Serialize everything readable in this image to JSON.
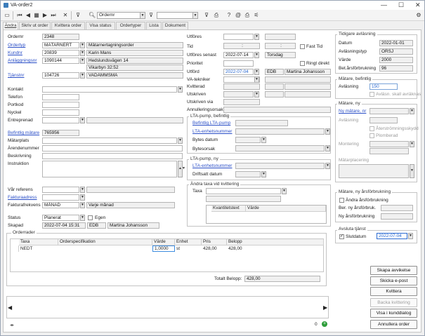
{
  "window": {
    "title": "VA-order2",
    "min": "—",
    "max": "☐",
    "close": "✕"
  },
  "toolbar": {
    "search_label": "Ordernr",
    "search_value": ""
  },
  "tabs": [
    "Ändra",
    "Skriv ut order",
    "Kvittera order",
    "Visa status",
    "Ordertyper",
    "Lista",
    "Dokument"
  ],
  "left": {
    "ordernr_label": "Ordernr",
    "ordernr": "2348",
    "ordertyp_label": "Ordertyp",
    "ordertyp": "MÄTARNERT",
    "ordertyp_desc": "Mätarnertagningsorder",
    "kundnr_label": "Kundnr",
    "kundnr": "20839",
    "kund_namn": "Karin Mans",
    "anlaggning_label": "Anläggningsnr",
    "anlaggning": "1090144",
    "adress1": "Hedslundsvägen 14",
    "adress2": "Vikarbyn 32:52",
    "tjanst_label": "Tjänstnr",
    "tjanst": "104726",
    "tjanst_desc": "VADÄMMSMÄ",
    "kontakt_label": "Kontakt",
    "telefon_label": "Telefon",
    "portkod_label": "Portkod",
    "nyckel_label": "Nyckel",
    "entreprenad_label": "Entreprenad",
    "matare_label": "Befintlig mätare",
    "matare": "765956",
    "matarplats_label": "Mätarplats",
    "arendenummer_label": "Ärendenummer",
    "beskrivning_label": "Beskrivning",
    "instruktion_label": "Instruktion",
    "referens_label": "Vår referens",
    "faktura_label": "Fakturaadress",
    "frekvens_label": "Fakturafrekvens",
    "frekvens": "MÅNAD",
    "frekvens_desc": "Varje månad",
    "status_label": "Status",
    "status": "Planerat",
    "egen_label": "Egen",
    "skapad_label": "Skapad",
    "skapad": "2022-07-04 15:31",
    "skapad_av": "EDB",
    "skapad_namn": "Martina Johansson"
  },
  "mid": {
    "utfores_label": "Utföres",
    "tid_label": "Tid",
    "tid_sep": ":",
    "utfores_senast_label": "Utföres senast",
    "utfores_senast": "2022-07-14",
    "dag": "Torsdag",
    "fast_tid_label": "Fast Tid",
    "prioritet_label": "Prioritet",
    "ringt_label": "Ringt direkt",
    "utford_label": "Utförd",
    "utford": "2022-07-04",
    "utford_av": "EDB",
    "utford_namn": "Martina Johansson",
    "vatekniker_label": "VA-tekniker",
    "kvitterad_label": "Kvitterad",
    "utskriven_label": "Utskriven",
    "utskriven_via_label": "Utskriven via",
    "annullering_label": "Annulleringsorsak",
    "lta_bef_title": "LTA-pump, befintlig",
    "lta_bef_pump": "Befintlig LTA-pump",
    "lta_bef_enhet": "LTA-enhetsnummer",
    "bytes_datum": "Bytes datum",
    "bytesorsak": "Bytesorsak",
    "lta_ny_title": "LTA-pump, ny",
    "lta_ny_enhet": "LTA-enhetsnummer",
    "driftsatt": "Driftsatt datum",
    "taxa_title": "Ändra taxa vid kvittering",
    "taxa_label": "Taxa",
    "taxa_col1": "Kvantitetstext",
    "taxa_col2": "Värde"
  },
  "right": {
    "tidigare_title": "Tidigare avläsning",
    "datum_label": "Datum",
    "datum": "2022-01-01",
    "typ_label": "Avläsningstyp",
    "typ": "ORSJ",
    "varde_label": "Värde",
    "varde": "2000",
    "bet_label": "Bet.årsförbrukning",
    "bet": "96",
    "bef_title": "Mätare, befintlig",
    "avl_label": "Avläsning",
    "avl": "150",
    "avl_chk_label": "Avläsn. skall avräknas",
    "ny_title": "Mätare, ny",
    "ny_matare_label": "Ny mätare, nr",
    "ny_avl_label": "Avläsning",
    "aterstr_label": "Återströmningsskydd",
    "plomb_label": "Plomberad",
    "montering_label": "Montering",
    "placering_label": "Mätarplacering",
    "ars_title": "Mätare, ny årsförbrukning",
    "andra_ars_label": "Ändra årsförbrukning",
    "ber_label": "Ber. ny årsförbruk.",
    "ny_ars_label": "Ny årsförbrukning",
    "avsluta_title": "Avsluta tjänst",
    "slutdatum_label": "Slutdatum",
    "slutdatum": "2022-07-04"
  },
  "orderrader": {
    "title": "Orderrader",
    "columns": [
      "Taxa",
      "Orderspecifikation",
      "Värde",
      "Enhet",
      "Pris",
      "Belopp"
    ],
    "rows": [
      {
        "taxa": "NEDT",
        "spec": "",
        "varde": "1,0000",
        "enhet": "st",
        "pris": "428,00",
        "belopp": "428,00"
      }
    ],
    "total_label": "Totalt Belopp:",
    "total": "428,00"
  },
  "buttons": [
    "Skapa avvikelse",
    "Skicka e-post",
    "Kvittera",
    "Backa kvittering",
    "Visa i kunddialog",
    "Annullera order"
  ],
  "bottom": {
    "count": "0",
    "count_prefix": "0"
  }
}
